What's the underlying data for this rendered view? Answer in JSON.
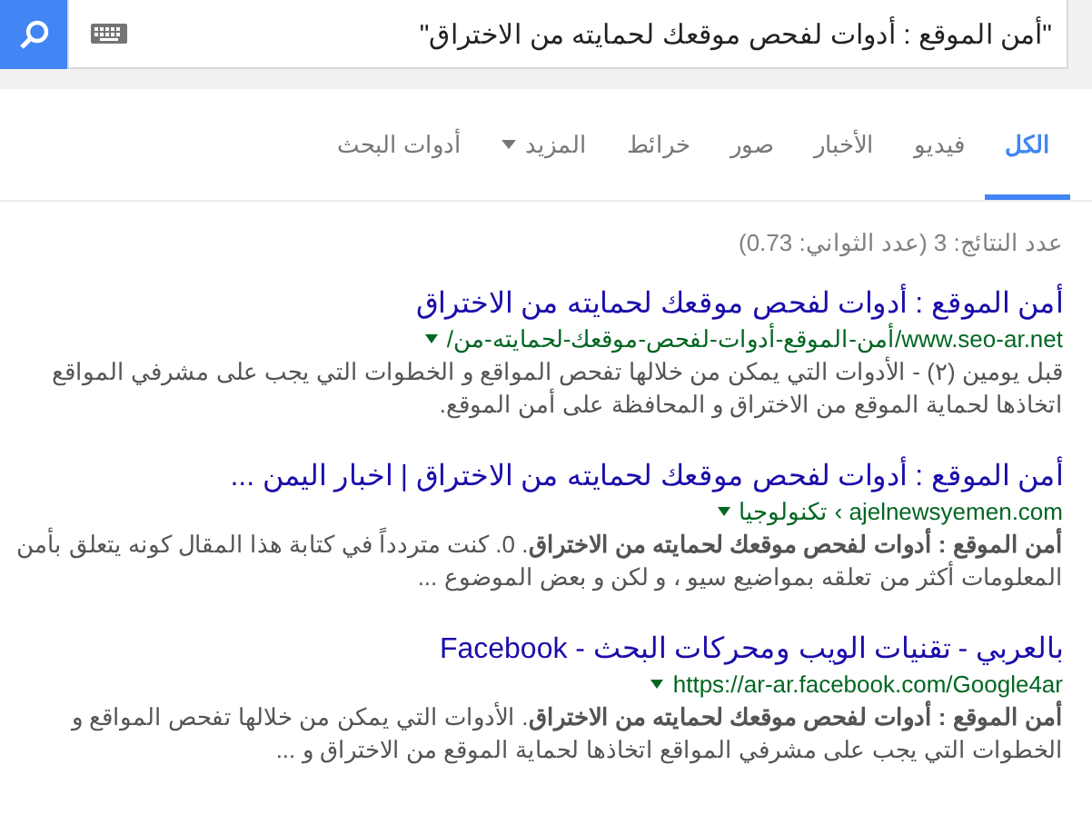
{
  "search": {
    "value": "\"أمن الموقع : أدوات لفحص موقعك لحمايته من الاختراق\""
  },
  "tabs": [
    {
      "label": "الكل",
      "selected": true,
      "dropdown": false
    },
    {
      "label": "فيديو",
      "selected": false,
      "dropdown": false
    },
    {
      "label": "الأخبار",
      "selected": false,
      "dropdown": false
    },
    {
      "label": "صور",
      "selected": false,
      "dropdown": false
    },
    {
      "label": "خرائط",
      "selected": false,
      "dropdown": false
    },
    {
      "label": "المزيد",
      "selected": false,
      "dropdown": true
    },
    {
      "label": "أدوات البحث",
      "selected": false,
      "dropdown": false
    }
  ],
  "stats": "عدد النتائج: 3 (عدد الثواني: 0.73)",
  "results": [
    {
      "title": "أمن الموقع : أدوات لفحص موقعك لحمايته من الاختراق",
      "url": "www.seo-ar.net/أمن-الموقع-أدوات-لفحص-موقعك-لحمايته-من/",
      "snippet": "قبل يومين (٢) - الأدوات التي يمكن من خلالها تفحص المواقع و الخطوات التي يجب على مشرفي المواقع اتخاذها لحماية الموقع من الاختراق و المحافظة على أمن الموقع."
    },
    {
      "title": "أمن الموقع : أدوات لفحص موقعك لحمايته من الاختراق | اخبار اليمن ...",
      "url": "ajelnewsyemen.com › تكنولوجيا",
      "snippet": "**أمن الموقع : أدوات لفحص موقعك لحمايته من الاختراق**. 0. كنت متردداً في كتابة هذا المقال كونه يتعلق بأمن المعلومات أكثر من تعلقه بمواضيع سيو ، و لكن و بعض الموضوع ..."
    },
    {
      "title": "بالعربي - تقنيات الويب ومحركات البحث - Facebook",
      "url": "https://ar-ar.facebook.com/Google4ar",
      "snippet": "**أمن الموقع : أدوات لفحص موقعك لحمايته من الاختراق**. الأدوات التي يمكن من خلالها تفحص المواقع و الخطوات التي يجب على مشرفي المواقع اتخاذها لحماية الموقع من الاختراق و ..."
    }
  ]
}
